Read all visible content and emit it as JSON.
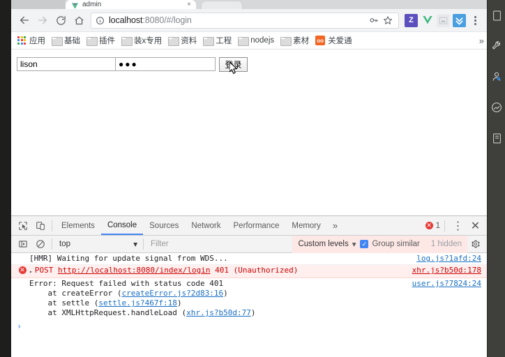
{
  "window": {
    "tab": {
      "title": "admin",
      "close_label": "×",
      "favicon": "vue-favicon"
    }
  },
  "toolbar": {
    "back_label": "←",
    "forward_label": "→",
    "reload_label": "C",
    "home_label": "⌂",
    "url_host": "localhost",
    "url_rest": ":8080/#/login",
    "key_icon": "key-icon",
    "star_icon": "star-icon",
    "extensions": [
      {
        "name": "ext-zotero",
        "label": "Z",
        "color": "#5b4fbe",
        "class": "ext-z"
      },
      {
        "name": "ext-vue-devtools",
        "label": "V",
        "color": "#41b883",
        "class": "ext-v"
      },
      {
        "name": "ext-grey",
        "label": "▤",
        "color": "#9aa0a6",
        "class": "ext-g"
      },
      {
        "name": "ext-blue",
        "label": "⌕",
        "color": "#4a9fe0",
        "class": "ext-b"
      }
    ],
    "menu_label": "chrome-menu"
  },
  "bookmarks": {
    "overflow_label": "»",
    "items": [
      {
        "label": "应用",
        "icon": "apps-grid-icon"
      },
      {
        "label": "基础",
        "icon": "folder-icon"
      },
      {
        "label": "插件",
        "icon": "folder-icon"
      },
      {
        "label": "装x专用",
        "icon": "folder-icon"
      },
      {
        "label": "资料",
        "icon": "folder-icon"
      },
      {
        "label": "工程",
        "icon": "folder-icon"
      },
      {
        "label": "nodejs",
        "icon": "folder-icon"
      },
      {
        "label": "素材",
        "icon": "folder-icon"
      },
      {
        "label": "关爱通",
        "icon": "gat-icon"
      }
    ]
  },
  "page": {
    "username_value": "lison",
    "password_value": "●●●",
    "login_button_label": "登录"
  },
  "devtools": {
    "inspect_icon": "inspect-element-icon",
    "device_icon": "device-toolbar-icon",
    "tabs": [
      {
        "label": "Elements",
        "active": false
      },
      {
        "label": "Console",
        "active": true
      },
      {
        "label": "Sources",
        "active": false
      },
      {
        "label": "Network",
        "active": false
      },
      {
        "label": "Performance",
        "active": false
      },
      {
        "label": "Memory",
        "active": false
      }
    ],
    "more_tabs_label": "»",
    "error_count": "1",
    "settings_menu_label": "⋮",
    "close_label": "✕",
    "filterbar": {
      "sidebar_icon": "console-sidebar-icon",
      "clear_icon": "clear-console-icon",
      "context": "top",
      "context_caret": "▾",
      "filter_placeholder": "Filter",
      "levels_label": "Custom levels",
      "levels_caret": "▾",
      "group_similar_label": "Group similar",
      "group_similar_checked": true,
      "check_glyph": "✓",
      "hidden_label": "1 hidden",
      "gear_icon": "settings-gear-icon"
    },
    "messages": [
      {
        "type": "log",
        "expand": "",
        "text": "[HMR] Waiting for update signal from WDS...",
        "source": "log.js?1afd:24"
      },
      {
        "type": "error",
        "expand": "▸",
        "prefix": "POST ",
        "url": "http://localhost:8080/index/login",
        "suffix": " 401 (Unauthorized)",
        "source": "xhr.js?b50d:178"
      },
      {
        "type": "error-detail",
        "text": "Error: Request failed with status code 401",
        "source": "user.js?7824:24",
        "stack": [
          {
            "pre": "    at createError (",
            "link": "createError.js?2d83:16",
            "post": ")"
          },
          {
            "pre": "    at settle (",
            "link": "settle.js?467f:18",
            "post": ")"
          },
          {
            "pre": "    at XMLHttpRequest.handleLoad (",
            "link": "xhr.js?b50d:77",
            "post": ")"
          }
        ]
      }
    ],
    "prompt_glyph": "›"
  },
  "dock": {
    "items": [
      {
        "name": "dock-document-icon",
        "glyph": "❐"
      },
      {
        "name": "dock-wrench-icon",
        "glyph": "⚒"
      },
      {
        "name": "dock-person-icon",
        "glyph": "☺"
      },
      {
        "name": "dock-ban-icon",
        "glyph": "⊘"
      },
      {
        "name": "dock-note-icon",
        "glyph": "☐"
      }
    ]
  }
}
